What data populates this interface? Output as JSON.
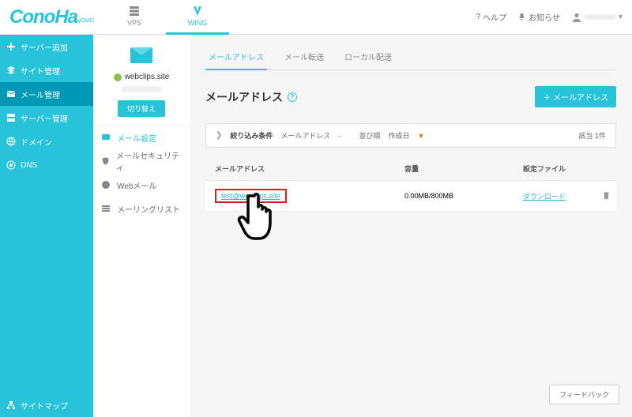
{
  "header": {
    "logo": "ConoHa",
    "logo_sub": "byGMO",
    "tabs": [
      {
        "id": "vps",
        "label": "VPS",
        "active": false
      },
      {
        "id": "wing",
        "label": "WING",
        "active": true
      }
    ],
    "help": "ヘルプ",
    "notice": "お知らせ"
  },
  "sidebar": {
    "items": [
      {
        "icon": "plus",
        "label": "サーバー追加"
      },
      {
        "icon": "layers",
        "label": "サイト管理"
      },
      {
        "icon": "mail",
        "label": "メール管理",
        "active": true
      },
      {
        "icon": "server",
        "label": "サーバー管理"
      },
      {
        "icon": "globe",
        "label": "ドメイン"
      },
      {
        "icon": "globe-ring",
        "label": "DNS"
      }
    ],
    "sitemap": "サイトマップ"
  },
  "subpanel": {
    "site": "webclips.site",
    "switch": "切り替え",
    "items": [
      {
        "label": "メール設定",
        "active": true
      },
      {
        "label": "メールセキュリティ",
        "active": false
      },
      {
        "label": "Webメール",
        "active": false
      },
      {
        "label": "メーリングリスト",
        "active": false
      }
    ]
  },
  "main": {
    "tabs": [
      {
        "label": "メールアドレス",
        "active": true
      },
      {
        "label": "メール転送",
        "active": false
      },
      {
        "label": "ローカル配送",
        "active": false
      }
    ],
    "title": "メールアドレス",
    "add_btn": "＋ メールアドレス",
    "filter": {
      "label": "絞り込み条件",
      "field1_label": "メールアドレス",
      "field1_value": "-",
      "sort_label": "並び順",
      "sort_value": "作成日",
      "count": "該当 1件"
    },
    "columns": {
      "addr": "メールアドレス",
      "cap": "容量",
      "file": "設定ファイル"
    },
    "rows": [
      {
        "address": "test@webclips.site",
        "capacity": "0.00MB/800MB",
        "download": "ダウンロード"
      }
    ],
    "feedback": "フィードバック"
  }
}
